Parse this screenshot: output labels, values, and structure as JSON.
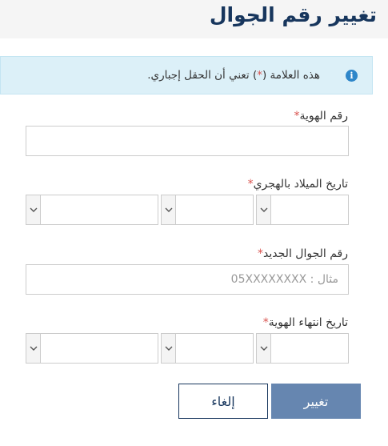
{
  "page": {
    "title": "تغيير رقم الجوال"
  },
  "notice": {
    "prefix": "هذه العلامة (",
    "mark": "*",
    "suffix": ") تعني أن الحقل إجباري."
  },
  "form": {
    "id_number": {
      "label": "رقم الهوية",
      "value": ""
    },
    "birth_date": {
      "label": "تاريخ الميلاد بالهجري"
    },
    "new_mobile": {
      "label": "رقم الجوال الجديد",
      "placeholder": "مثال : 05XXXXXXXX",
      "value": ""
    },
    "id_expiry": {
      "label": "تاريخ انتهاء الهوية"
    },
    "required_mark": "*"
  },
  "actions": {
    "submit_label": "تغيير",
    "cancel_label": "إلغاء"
  },
  "colors": {
    "title": "#17365d",
    "notice_bg": "#dcf0f8",
    "info_icon": "#2e86c9",
    "required": "#d9534f",
    "submit_bg": "#6686b0"
  },
  "icons": {
    "info": "info-icon",
    "dropdown": "chevron-down-icon"
  }
}
